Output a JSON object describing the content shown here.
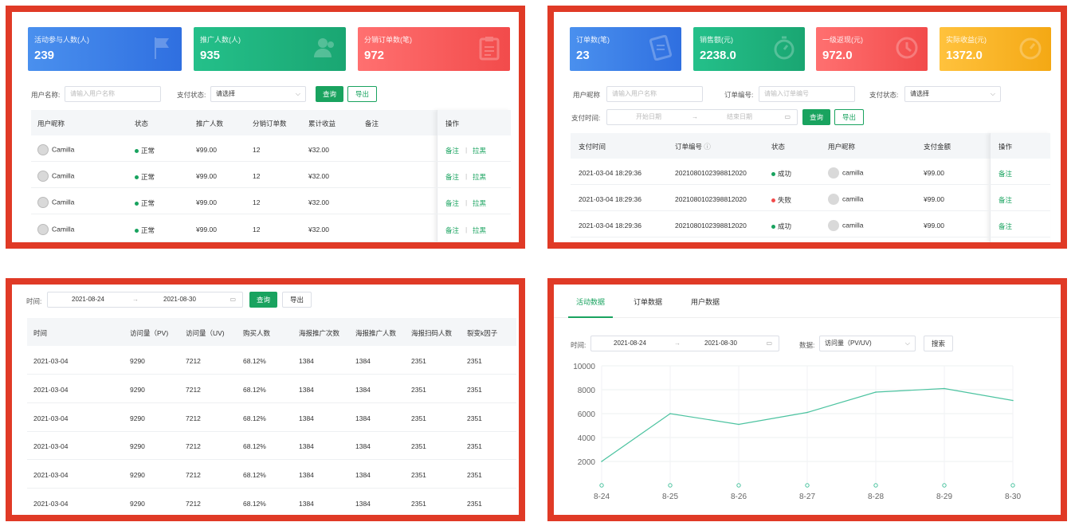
{
  "colors": {
    "accent": "#19a35f",
    "frame": "#e03a26",
    "success": "#19a35f",
    "fail": "#f24b4b"
  },
  "panel1": {
    "cards": [
      {
        "label": "活动参与人数(人)",
        "value": "239",
        "icon": "flag-icon"
      },
      {
        "label": "推广人数(人)",
        "value": "935",
        "icon": "users-icon"
      },
      {
        "label": "分销订单数(笔)",
        "value": "972",
        "icon": "clipboard-icon"
      }
    ],
    "filters": {
      "user_label": "用户名称:",
      "user_placeholder": "请输入用户名称",
      "pay_label": "支付状态:",
      "pay_value": "请选择",
      "query": "查询",
      "export": "导出"
    },
    "columns": [
      "用户昵称",
      "状态",
      "推广人数",
      "分销订单数",
      "累计收益",
      "备注",
      "操作"
    ],
    "rows": [
      {
        "name": "Camilla",
        "status": "正常",
        "promo": "¥99.00",
        "orders": "12",
        "income": "¥32.00"
      },
      {
        "name": "Camilla",
        "status": "正常",
        "promo": "¥99.00",
        "orders": "12",
        "income": "¥32.00"
      },
      {
        "name": "Camilla",
        "status": "正常",
        "promo": "¥99.00",
        "orders": "12",
        "income": "¥32.00"
      },
      {
        "name": "Camilla",
        "status": "正常",
        "promo": "¥99.00",
        "orders": "12",
        "income": "¥32.00"
      }
    ],
    "actions": {
      "note": "备注",
      "sep": "|",
      "block": "拉黑"
    }
  },
  "panel2": {
    "cards": [
      {
        "label": "订单数(笔)",
        "value": "23",
        "icon": "document-icon"
      },
      {
        "label": "销售额(元)",
        "value": "2238.0",
        "icon": "stopwatch-icon"
      },
      {
        "label": "一级返现(元)",
        "value": "972.0",
        "icon": "clock-icon"
      },
      {
        "label": "实际收益(元)",
        "value": "1372.0",
        "icon": "timer-icon"
      }
    ],
    "filters": {
      "nick_label": "用户昵称",
      "nick_placeholder": "请输入用户名称",
      "order_label": "订单编号:",
      "order_placeholder": "请输入订单编号",
      "pay_label": "支付状态:",
      "pay_value": "请选择",
      "time_label": "支付时间:",
      "start": "开始日期",
      "arrow": "→",
      "end": "结束日期",
      "query": "查询",
      "export": "导出"
    },
    "columns": [
      "支付时间",
      "订单编号",
      "状态",
      "用户昵称",
      "支付金额",
      "操作"
    ],
    "rows": [
      {
        "time": "2021-03-04 18:29:36",
        "order": "2021080102398812020",
        "status": "成功",
        "status_type": "success",
        "nick": "camilla",
        "amount": "¥99.00"
      },
      {
        "time": "2021-03-04 18:29:36",
        "order": "2021080102398812020",
        "status": "失败",
        "status_type": "fail",
        "nick": "camilla",
        "amount": "¥99.00"
      },
      {
        "time": "2021-03-04 18:29:36",
        "order": "2021080102398812020",
        "status": "成功",
        "status_type": "success",
        "nick": "camilla",
        "amount": "¥99.00"
      }
    ],
    "action": "备注"
  },
  "panel3": {
    "filters": {
      "time_label": "时间:",
      "start": "2021-08-24",
      "arrow": "→",
      "end": "2021-08-30",
      "query": "查询",
      "export": "导出"
    },
    "columns": [
      "时间",
      "访问量（PV)",
      "访问量（UV)",
      "购买人数",
      "海报推广次数",
      "海报推广人数",
      "海报扫码人数",
      "裂变k因子"
    ],
    "rows": [
      [
        "2021-03-04",
        "9290",
        "7212",
        "68.12%",
        "1384",
        "1384",
        "2351",
        "2351"
      ],
      [
        "2021-03-04",
        "9290",
        "7212",
        "68.12%",
        "1384",
        "1384",
        "2351",
        "2351"
      ],
      [
        "2021-03-04",
        "9290",
        "7212",
        "68.12%",
        "1384",
        "1384",
        "2351",
        "2351"
      ],
      [
        "2021-03-04",
        "9290",
        "7212",
        "68.12%",
        "1384",
        "1384",
        "2351",
        "2351"
      ],
      [
        "2021-03-04",
        "9290",
        "7212",
        "68.12%",
        "1384",
        "1384",
        "2351",
        "2351"
      ],
      [
        "2021-03-04",
        "9290",
        "7212",
        "68.12%",
        "1384",
        "1384",
        "2351",
        "2351"
      ]
    ]
  },
  "panel4": {
    "tabs": [
      "活动数据",
      "订单数据",
      "用户数据"
    ],
    "filters": {
      "time_label": "时间:",
      "start": "2021-08-24",
      "arrow": "→",
      "end": "2021-08-30",
      "data_label": "数据:",
      "data_value": "访问量（PV/UV)",
      "search": "搜索"
    },
    "chart_data": {
      "type": "line",
      "x": [
        "8-24",
        "8-25",
        "8-26",
        "8-27",
        "8-28",
        "8-29",
        "8-30"
      ],
      "series": [
        {
          "values": [
            2000,
            6000,
            5100,
            6100,
            7800,
            8100,
            7100
          ]
        }
      ],
      "yticks": [
        "10000",
        "8000",
        "6000",
        "4000",
        "2000"
      ],
      "ylim": [
        0,
        10000
      ],
      "grid": true,
      "color": "#4cc3a0"
    }
  }
}
